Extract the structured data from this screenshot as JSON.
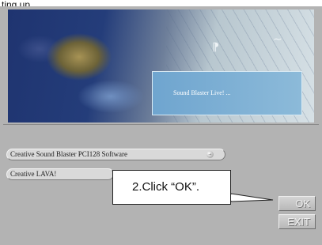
{
  "page": {
    "heading_partial": "ting up"
  },
  "banner": {
    "box_text": "Sound  Blaster  Live!  ..."
  },
  "items": [
    {
      "label": "Creative Sound Blaster PCI128 Software",
      "icon": "→"
    },
    {
      "label": "Creative LAVA!"
    }
  ],
  "callout": {
    "text": "2.Click “OK”."
  },
  "buttons": {
    "ok_label": "OK",
    "exit_label": "EXIT"
  }
}
